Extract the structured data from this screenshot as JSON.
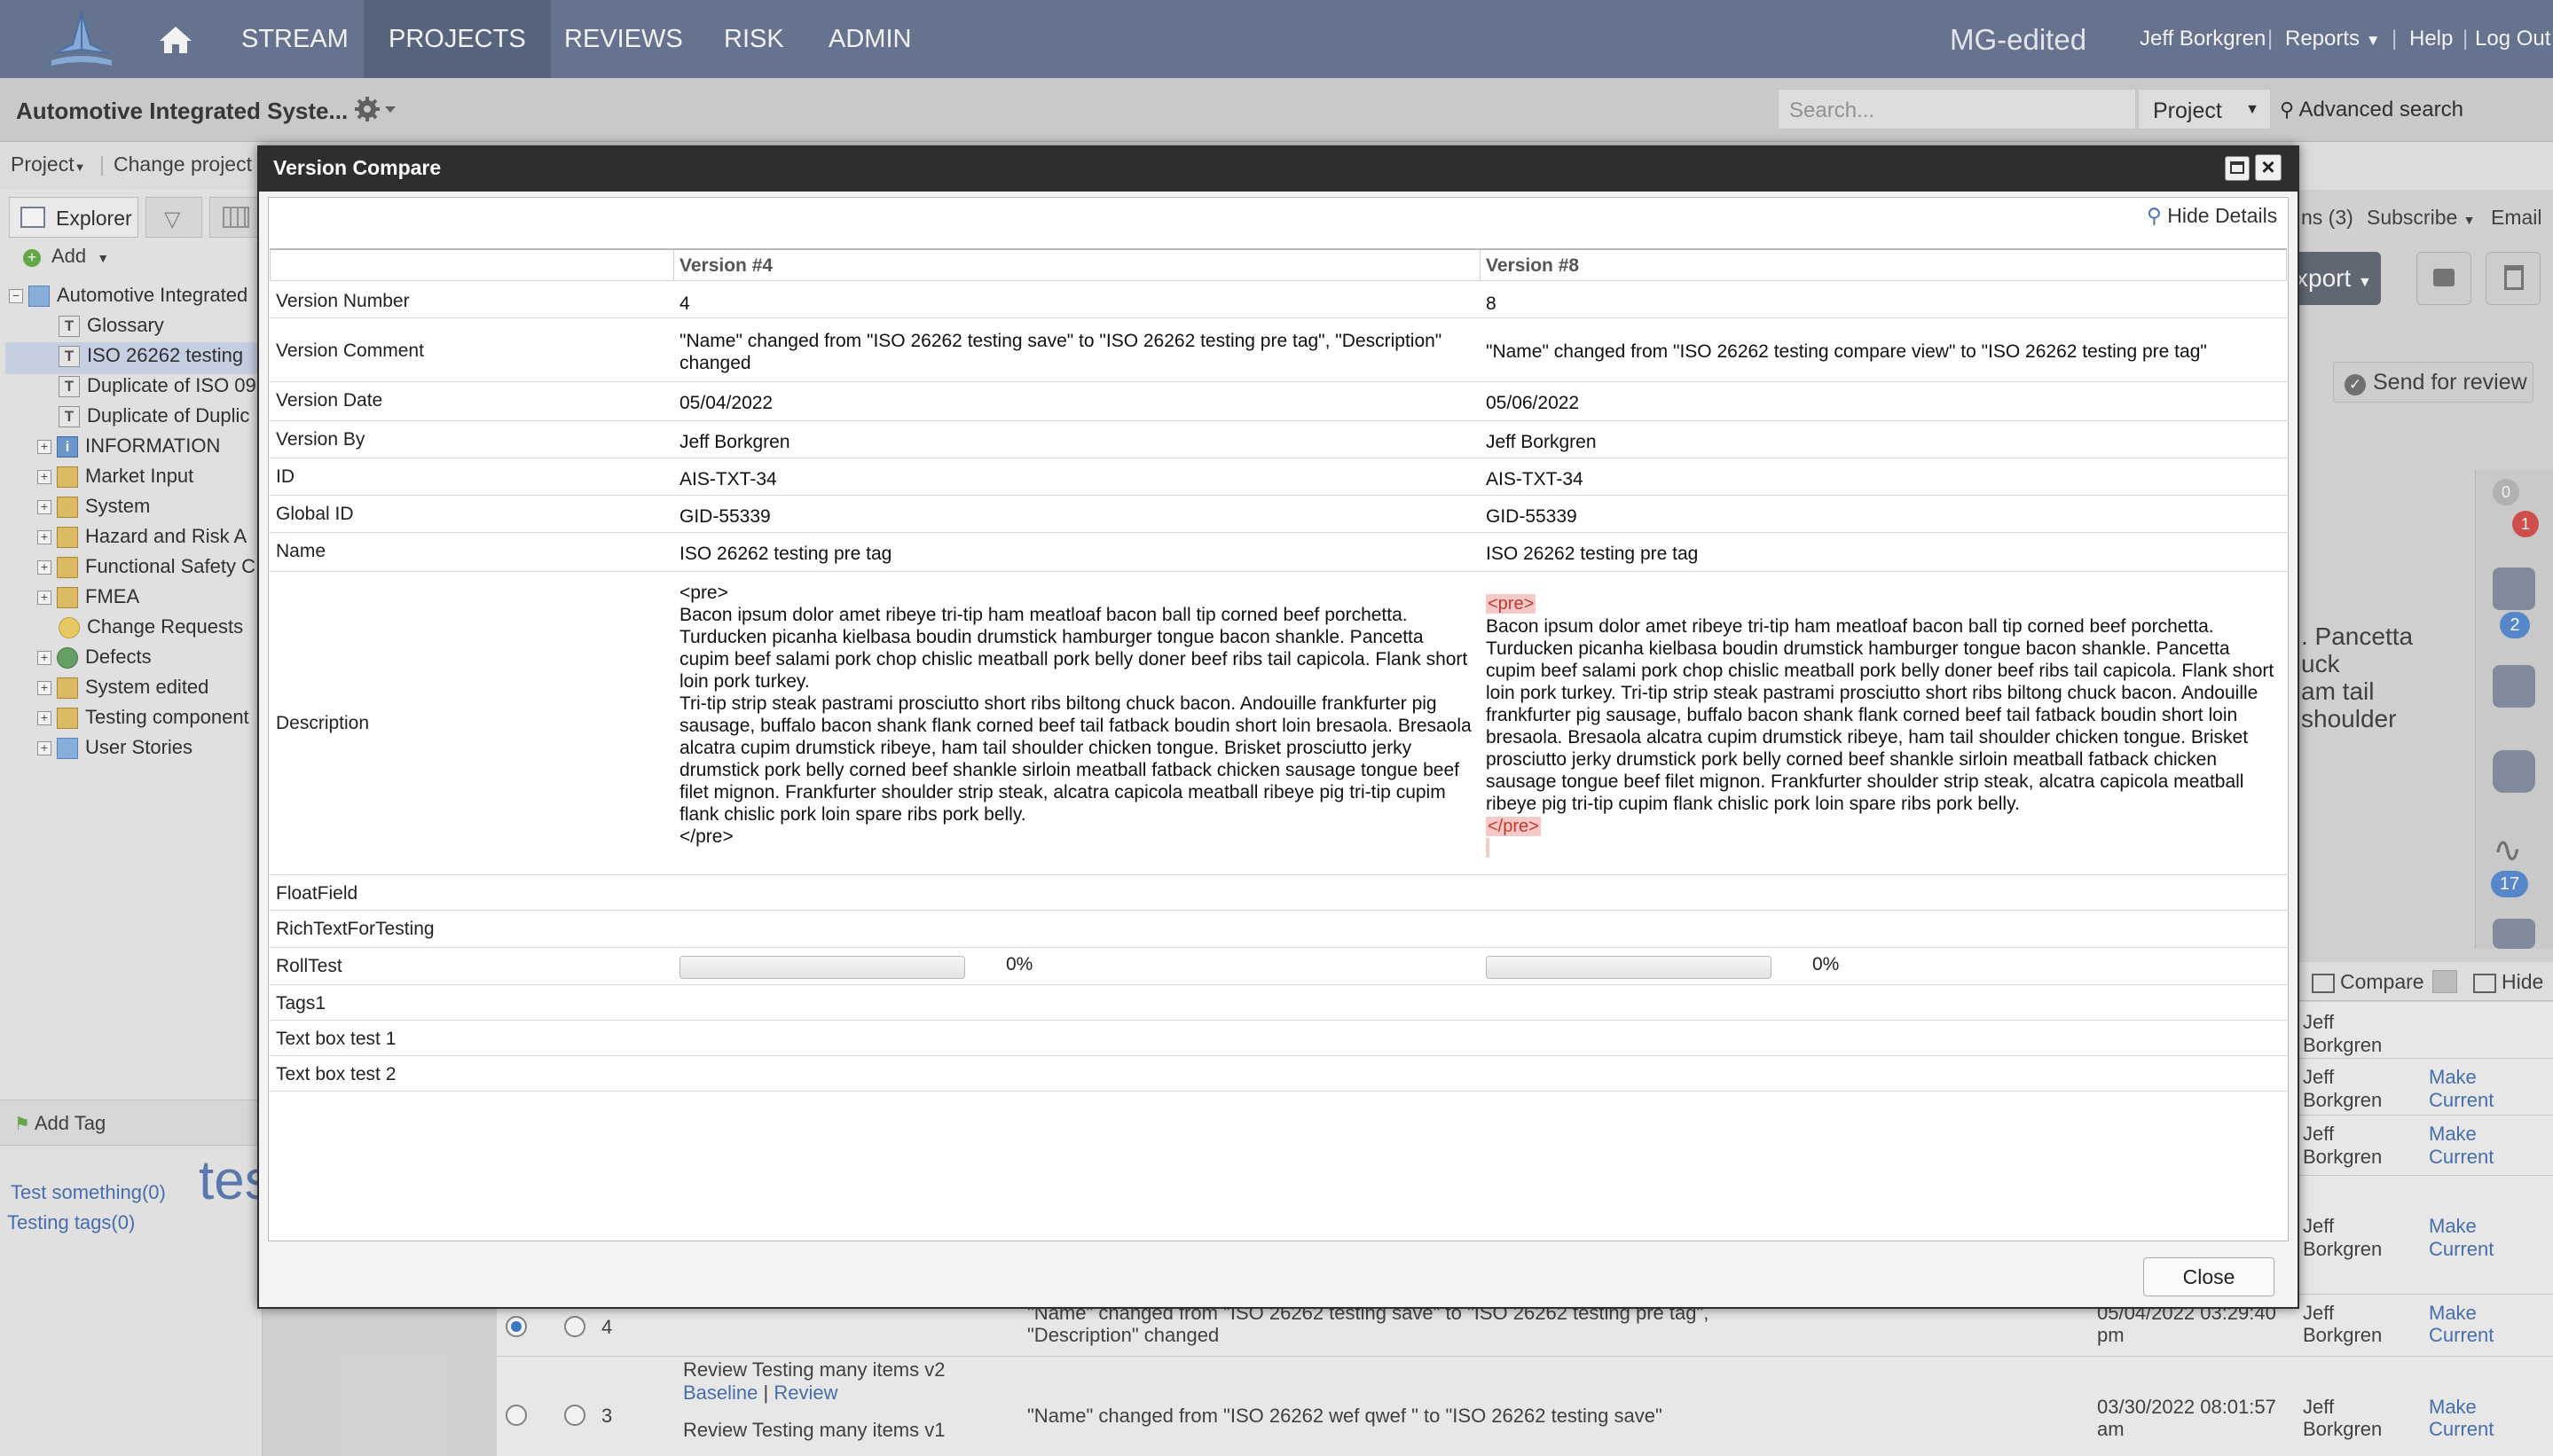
{
  "nav": {
    "items": [
      "STREAM",
      "PROJECTS",
      "REVIEWS",
      "RISK",
      "ADMIN"
    ],
    "brand": "MG-edited",
    "user": "Jeff Borkgren",
    "reports": "Reports",
    "help": "Help",
    "logout": "Log Out",
    "separator": "|"
  },
  "project_bar": {
    "title": "Automotive Integrated Syste...",
    "search_placeholder": "Search...",
    "scope": "Project",
    "advanced_search": "Advanced search"
  },
  "toolbar": {
    "project_menu": "Project",
    "change_project": "Change project"
  },
  "left_panel": {
    "explorer_tab": "Explorer",
    "add": "Add",
    "tree": [
      {
        "label": "Automotive Integrated",
        "kind": "root"
      },
      {
        "label": "Glossary",
        "kind": "text"
      },
      {
        "label": "ISO 26262 testing",
        "kind": "text",
        "selected": true
      },
      {
        "label": "Duplicate of ISO 09",
        "kind": "text"
      },
      {
        "label": "Duplicate of Duplic",
        "kind": "text"
      },
      {
        "label": "INFORMATION",
        "kind": "info"
      },
      {
        "label": "Market Input",
        "kind": "folder"
      },
      {
        "label": "System",
        "kind": "folder"
      },
      {
        "label": "Hazard and Risk A",
        "kind": "folder"
      },
      {
        "label": "Functional Safety C",
        "kind": "folder"
      },
      {
        "label": "FMEA",
        "kind": "folder"
      },
      {
        "label": "Change Requests",
        "kind": "bulb"
      },
      {
        "label": "Defects",
        "kind": "bug"
      },
      {
        "label": "System edited",
        "kind": "folder"
      },
      {
        "label": "Testing component",
        "kind": "folder"
      },
      {
        "label": "User Stories",
        "kind": "user"
      }
    ],
    "add_tag": "Add Tag",
    "tags": [
      "Test something(0)",
      "Testing tags(0)"
    ],
    "tag_cloud_word": "tes"
  },
  "background": {
    "items_tab": "ns (3)",
    "subscribe": "Subscribe",
    "email": "Email",
    "export": "xport",
    "send_for_review": "Send for review",
    "desc_fragment": [
      ". Pancetta",
      "uck",
      "am tail",
      "shoulder"
    ],
    "badges": [
      "0",
      "1",
      "2",
      "17"
    ],
    "compare": "Compare",
    "hide": "Hide",
    "rows": [
      {
        "author": "Jeff Borkgren",
        "action": ""
      },
      {
        "author": "Jeff Borkgren",
        "action": "Make Current"
      },
      {
        "author": "Jeff Borkgren",
        "action": "Make Current"
      },
      {
        "author": "Jeff Borkgren",
        "action": "Make Current"
      },
      {
        "version": "4",
        "comment": "\"Name\" changed from \"ISO 26262 testing save\" to \"ISO 26262 testing pre tag\", \"Description\" changed",
        "date": "05/04/2022 03:29:40 pm",
        "author": "Jeff Borkgren",
        "action": "Make Current"
      },
      {
        "version": "3",
        "reviews": [
          "Review Testing many items v2",
          "Baseline",
          "Review",
          "Review Testing many items v1"
        ],
        "comment": "\"Name\" changed from \"ISO 26262 wef qwef \" to \"ISO 26262 testing save\"",
        "date": "03/30/2022 08:01:57 am",
        "author": "Jeff Borkgren",
        "action": "Make Current"
      }
    ]
  },
  "modal": {
    "title": "Version Compare",
    "hide_details": "Hide Details",
    "close": "Close",
    "columns": [
      "Version #4",
      "Version #8"
    ],
    "rows": [
      {
        "label": "Version Number",
        "v4": "4",
        "v8": "8"
      },
      {
        "label": "Version Comment",
        "v4": "\"Name\" changed from \"ISO 26262 testing save\" to \"ISO 26262 testing pre tag\", \"Description\" changed",
        "v8": "\"Name\" changed from \"ISO 26262 testing compare view\" to \"ISO 26262 testing pre tag\""
      },
      {
        "label": "Version Date",
        "v4": "05/04/2022",
        "v8": "05/06/2022"
      },
      {
        "label": "Version By",
        "v4": "Jeff Borkgren",
        "v8": "Jeff Borkgren"
      },
      {
        "label": "ID",
        "v4": "AIS-TXT-34",
        "v8": "AIS-TXT-34"
      },
      {
        "label": "Global ID",
        "v4": "GID-55339",
        "v8": "GID-55339"
      },
      {
        "label": "Name",
        "v4": "ISO 26262 testing pre tag",
        "v8": "ISO 26262 testing pre tag"
      },
      {
        "label": "Description"
      },
      {
        "label": "FloatField"
      },
      {
        "label": "RichTextForTesting"
      },
      {
        "label": "RollTest"
      },
      {
        "label": "Tags1"
      },
      {
        "label": "Text box test 1"
      },
      {
        "label": "Text box test 2"
      }
    ],
    "description": {
      "v4": "<pre>\nBacon ipsum dolor amet ribeye tri-tip ham meatloaf bacon ball tip corned beef porchetta. Turducken picanha kielbasa boudin drumstick hamburger tongue bacon shankle. Pancetta cupim beef salami pork chop chislic meatball pork belly doner beef ribs tail capicola. Flank short loin pork turkey.\nTri-tip strip steak pastrami prosciutto short ribs biltong chuck bacon. Andouille frankfurter pig sausage, buffalo bacon shank flank corned beef tail fatback boudin short loin bresaola. Bresaola alcatra cupim drumstick ribeye, ham tail shoulder chicken tongue. Brisket prosciutto jerky drumstick pork belly corned beef shankle sirloin meatball fatback chicken sausage tongue beef filet mignon. Frankfurter shoulder strip steak, alcatra capicola meatball ribeye pig tri-tip cupim flank chislic pork loin spare ribs pork belly.\n</pre>",
      "v8_open": "<pre>",
      "v8_body": "Bacon ipsum dolor amet ribeye tri-tip ham meatloaf bacon ball tip corned beef porchetta. Turducken picanha kielbasa boudin drumstick hamburger tongue bacon shankle. Pancetta cupim beef salami pork chop chislic meatball pork belly doner beef ribs tail capicola. Flank short loin pork turkey. Tri-tip strip steak pastrami prosciutto short ribs biltong chuck bacon. Andouille frankfurter pig sausage, buffalo bacon shank flank corned beef tail fatback boudin short loin bresaola. Bresaola alcatra cupim drumstick ribeye, ham tail shoulder chicken tongue. Brisket prosciutto jerky drumstick pork belly corned beef shankle sirloin meatball fatback chicken sausage tongue beef filet mignon. Frankfurter shoulder strip steak, alcatra capicola meatball ribeye pig tri-tip cupim flank chislic pork loin spare ribs pork belly.",
      "v8_close": "</pre>"
    },
    "rolltest": {
      "v4_pct": "0%",
      "v8_pct": "0%",
      "v4_fraction": 0,
      "v8_fraction": 0
    }
  },
  "colors": {
    "nav_bg": "#6b7a96",
    "modal_header": "#2e2e2e",
    "link": "#4a74b5",
    "diff_bg": "#f6c9c9",
    "diff_text": "#c0392b"
  }
}
